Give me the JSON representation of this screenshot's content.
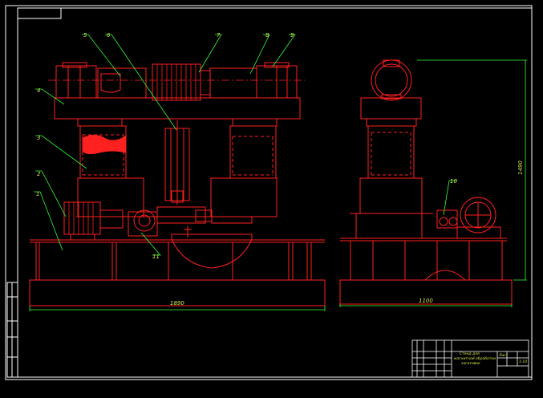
{
  "labels": {
    "p1": "1",
    "p2": "2",
    "p3": "3",
    "p4": "4",
    "p5": "5",
    "p6": "6",
    "p7": "7",
    "p8": "8",
    "p9": "9",
    "p10": "10",
    "p11": "11"
  },
  "dimensions": {
    "front_width": "1890",
    "side_width": "1100",
    "height": "1490"
  },
  "title_block": {
    "title_line1": "Стенд для",
    "title_line2": "магнитной обработки",
    "title_line3": "заготовок",
    "sheet": "Лист",
    "scale": "1:10"
  },
  "colors": {
    "frame": "#ffffff",
    "drawing": "#ff2020",
    "leaders": "#30ff30",
    "text": "#d7e84a"
  }
}
